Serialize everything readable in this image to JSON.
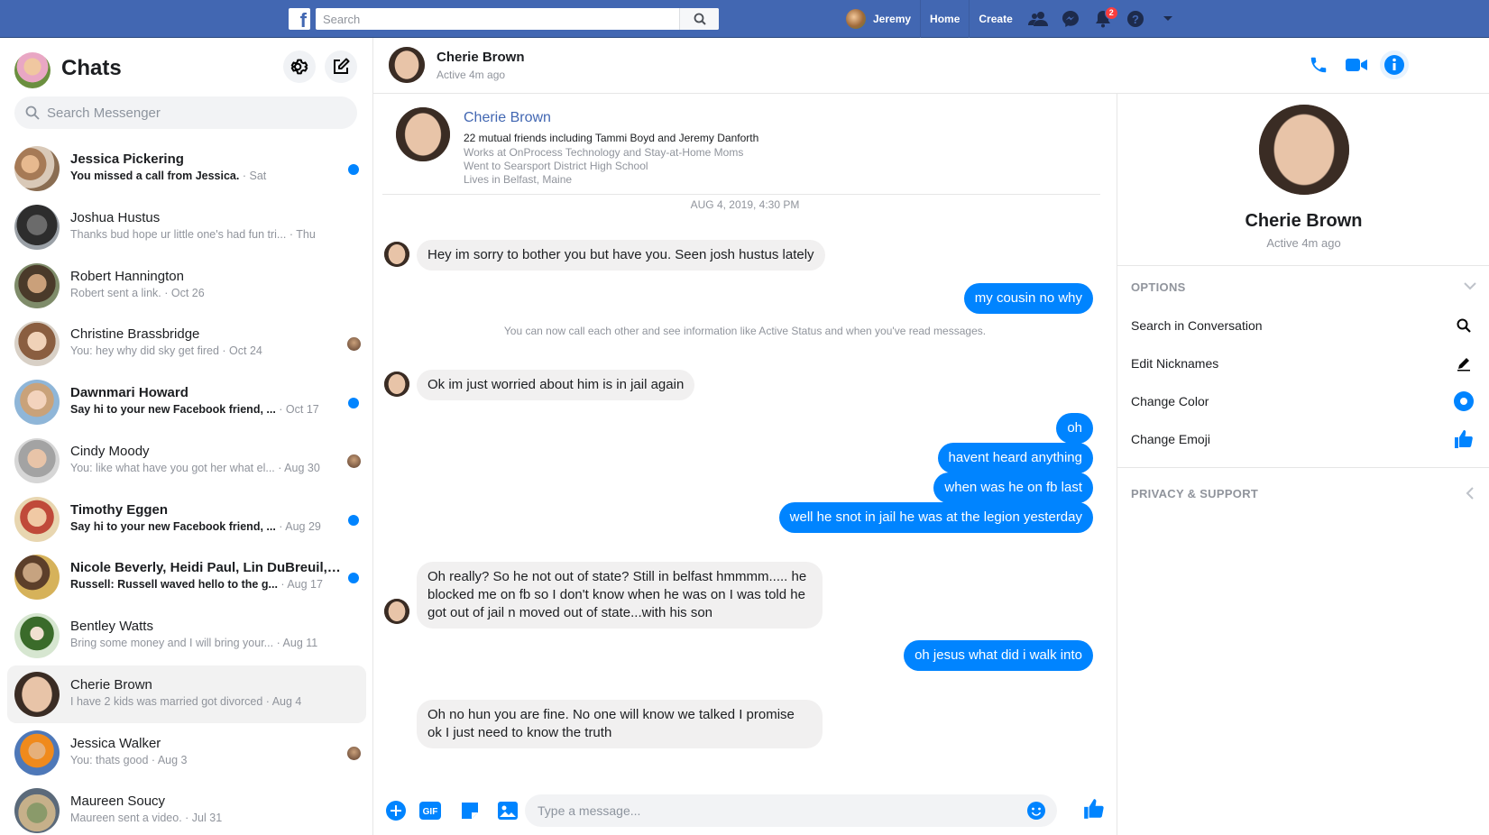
{
  "topbar": {
    "logo": "f",
    "search_placeholder": "Search",
    "user_name": "Jeremy",
    "home": "Home",
    "create": "Create",
    "notif_count": "2"
  },
  "sidebar": {
    "title": "Chats",
    "search_placeholder": "Search Messenger",
    "chats": [
      {
        "name": "Jessica Pickering",
        "text": "You missed a call from Jessica.",
        "time": " · Sat",
        "unread": true,
        "indicator": "dot"
      },
      {
        "name": "Joshua Hustus",
        "text": "Thanks bud hope ur little one's had fun tri...",
        "time": " · Thu",
        "unread": false,
        "indicator": ""
      },
      {
        "name": "Robert Hannington",
        "text": "Robert sent a link.",
        "time": " · Oct 26",
        "unread": false,
        "indicator": ""
      },
      {
        "name": "Christine Brassbridge",
        "text": "You: hey why did sky get fired",
        "time": " · Oct 24",
        "unread": false,
        "indicator": "seen"
      },
      {
        "name": "Dawnmari Howard",
        "text": "Say hi to your new Facebook friend, ...",
        "time": " · Oct 17",
        "unread": true,
        "indicator": "dot"
      },
      {
        "name": "Cindy Moody",
        "text": "You: like what have you got her what el...",
        "time": " · Aug 30",
        "unread": false,
        "indicator": "seen"
      },
      {
        "name": "Timothy Eggen",
        "text": "Say hi to your new Facebook friend, ...",
        "time": " · Aug 29",
        "unread": true,
        "indicator": "dot"
      },
      {
        "name": "Nicole Beverly, Heidi Paul, Lin DuBreuil, 1...",
        "text": "Russell: Russell waved hello to the g...",
        "time": " · Aug 17",
        "unread": true,
        "indicator": "dot"
      },
      {
        "name": "Bentley Watts",
        "text": "Bring some money and I will bring your...",
        "time": " · Aug 11",
        "unread": false,
        "indicator": ""
      },
      {
        "name": "Cherie Brown",
        "text": "I have 2 kids was married got divorced",
        "time": " · Aug 4",
        "unread": false,
        "indicator": "",
        "active": true
      },
      {
        "name": "Jessica Walker",
        "text": "You: thats good",
        "time": " · Aug 3",
        "unread": false,
        "indicator": "seen"
      },
      {
        "name": "Maureen Soucy",
        "text": "Maureen sent a video.",
        "time": " · Jul 31",
        "unread": false,
        "indicator": ""
      }
    ]
  },
  "conversation": {
    "name": "Cherie Brown",
    "status": "Active 4m ago",
    "card": {
      "name": "Cherie Brown",
      "mutual": "22 mutual friends including Tammi Boyd and Jeremy Danforth",
      "work": "Works at OnProcess Technology and Stay-at-Home Moms",
      "school": "Went to Searsport District High School",
      "lives": "Lives in Belfast, Maine"
    },
    "timestamp": "AUG 4, 2019, 4:30 PM",
    "system_note": "You can now call each other and see information like Active Status and when you've read messages.",
    "messages": [
      {
        "from": "in",
        "text": "Hey im sorry to bother you but have you. Seen josh hustus lately"
      },
      {
        "from": "out",
        "text": "my cousin no why"
      },
      {
        "from": "in",
        "text": "Ok im just worried about him is in jail again"
      },
      {
        "from": "out",
        "text": "oh"
      },
      {
        "from": "out",
        "text": "havent heard anything"
      },
      {
        "from": "out",
        "text": "when was he on fb last"
      },
      {
        "from": "out",
        "text": "well he snot in jail he was at the legion yesterday"
      },
      {
        "from": "in",
        "text": "Oh really? So he not out of state? Still in belfast hmmmm..... he blocked me on fb so I don't know when he was on I was told he got out of jail n moved out of state...with his son"
      },
      {
        "from": "out",
        "text": "oh jesus what did i walk into"
      },
      {
        "from": "in",
        "text": "Oh no hun you are fine. No one will know we talked I promise ok I just need to know the truth"
      }
    ],
    "composer_placeholder": "Type a message...",
    "gif_label": "GIF"
  },
  "info": {
    "name": "Cherie Brown",
    "status": "Active 4m ago",
    "options_title": "OPTIONS",
    "options": [
      {
        "label": "Search in Conversation"
      },
      {
        "label": "Edit Nicknames"
      },
      {
        "label": "Change Color"
      },
      {
        "label": "Change Emoji"
      }
    ],
    "privacy_title": "PRIVACY & SUPPORT"
  },
  "colors": {
    "accent": "#0084ff",
    "topbar": "#4267b2"
  }
}
